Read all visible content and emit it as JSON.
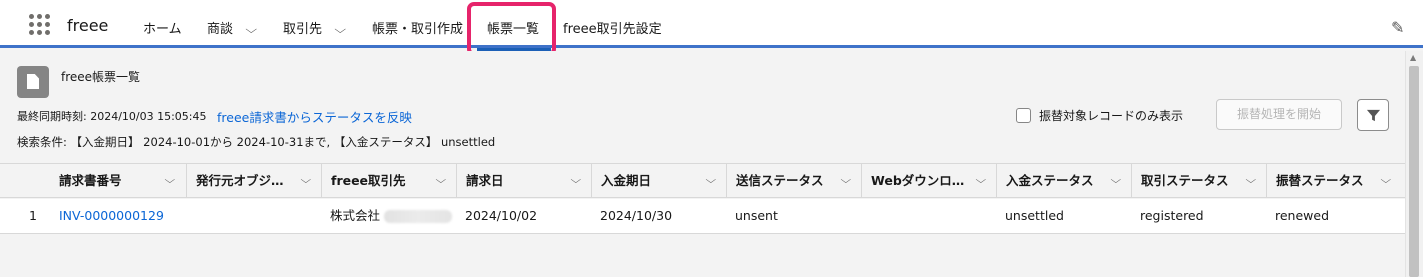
{
  "app": {
    "name": "freee"
  },
  "nav": {
    "items": [
      {
        "label": "ホーム",
        "dropdown": false
      },
      {
        "label": "商談",
        "dropdown": true
      },
      {
        "label": "取引先",
        "dropdown": true
      },
      {
        "label": "帳票・取引作成",
        "dropdown": false
      },
      {
        "label": "帳票一覧",
        "dropdown": false,
        "active": true
      },
      {
        "label": "freee取引先設定",
        "dropdown": false
      }
    ],
    "edit_icon": "pencil-icon"
  },
  "panel": {
    "icon": "document-icon",
    "title": "freee帳票一覧",
    "sync_label": "最終同期時刻: 2024/10/03 15:05:45",
    "sync_link": "freee請求書からステータスを反映",
    "conditions": "検索条件: 【入金期日】 2024-10-01から 2024-10-31まで, 【入金ステータス】 unsettled",
    "checkbox_label": "振替対象レコードのみ表示",
    "checkbox_checked": false,
    "action_button": "振替処理を開始",
    "filter_icon": "filter-icon"
  },
  "table": {
    "columns": [
      "請求書番号",
      "発行元オブジ…",
      "freee取引先",
      "請求日",
      "入金期日",
      "送信ステータス",
      "Webダウンロ…",
      "入金ステータス",
      "取引ステータス",
      "振替ステータス"
    ],
    "rows": [
      {
        "num": "1",
        "invoice_no": "INV-0000000129",
        "issuer": "",
        "partner": "株式会社",
        "invoice_date": "2024/10/02",
        "due_date": "2024/10/30",
        "send_status": "unsent",
        "web_download": "",
        "payment_status": "unsettled",
        "deal_status": "registered",
        "transfer_status": "renewed"
      }
    ]
  },
  "colors": {
    "nav_accent": "#3e72c9",
    "highlight": "#e6246b",
    "link": "#0b66d6"
  }
}
